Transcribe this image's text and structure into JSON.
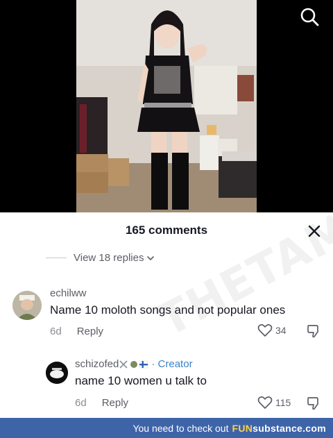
{
  "video": {
    "search_icon": "search-icon"
  },
  "comments_sheet": {
    "title": "165 comments",
    "close_icon": "close-icon",
    "view_replies": "View 18 replies",
    "comments": [
      {
        "username": "echilww",
        "text": "Name 10 moloth songs and not popular ones",
        "time": "6d",
        "reply_label": "Reply",
        "likes": "34"
      },
      {
        "username": "schizofed",
        "creator_label": "Creator",
        "text": "name 10 women u talk to",
        "time": "6d",
        "reply_label": "Reply",
        "likes": "115"
      }
    ]
  },
  "banner": {
    "text": "You need to check out",
    "brand_fun": "FUN",
    "brand_rest": "substance.com"
  },
  "colors": {
    "banner_bg": "#3e64a8",
    "creator_blue": "#3e82c5",
    "text_primary": "#161823",
    "text_secondary": "#5c5e66"
  }
}
